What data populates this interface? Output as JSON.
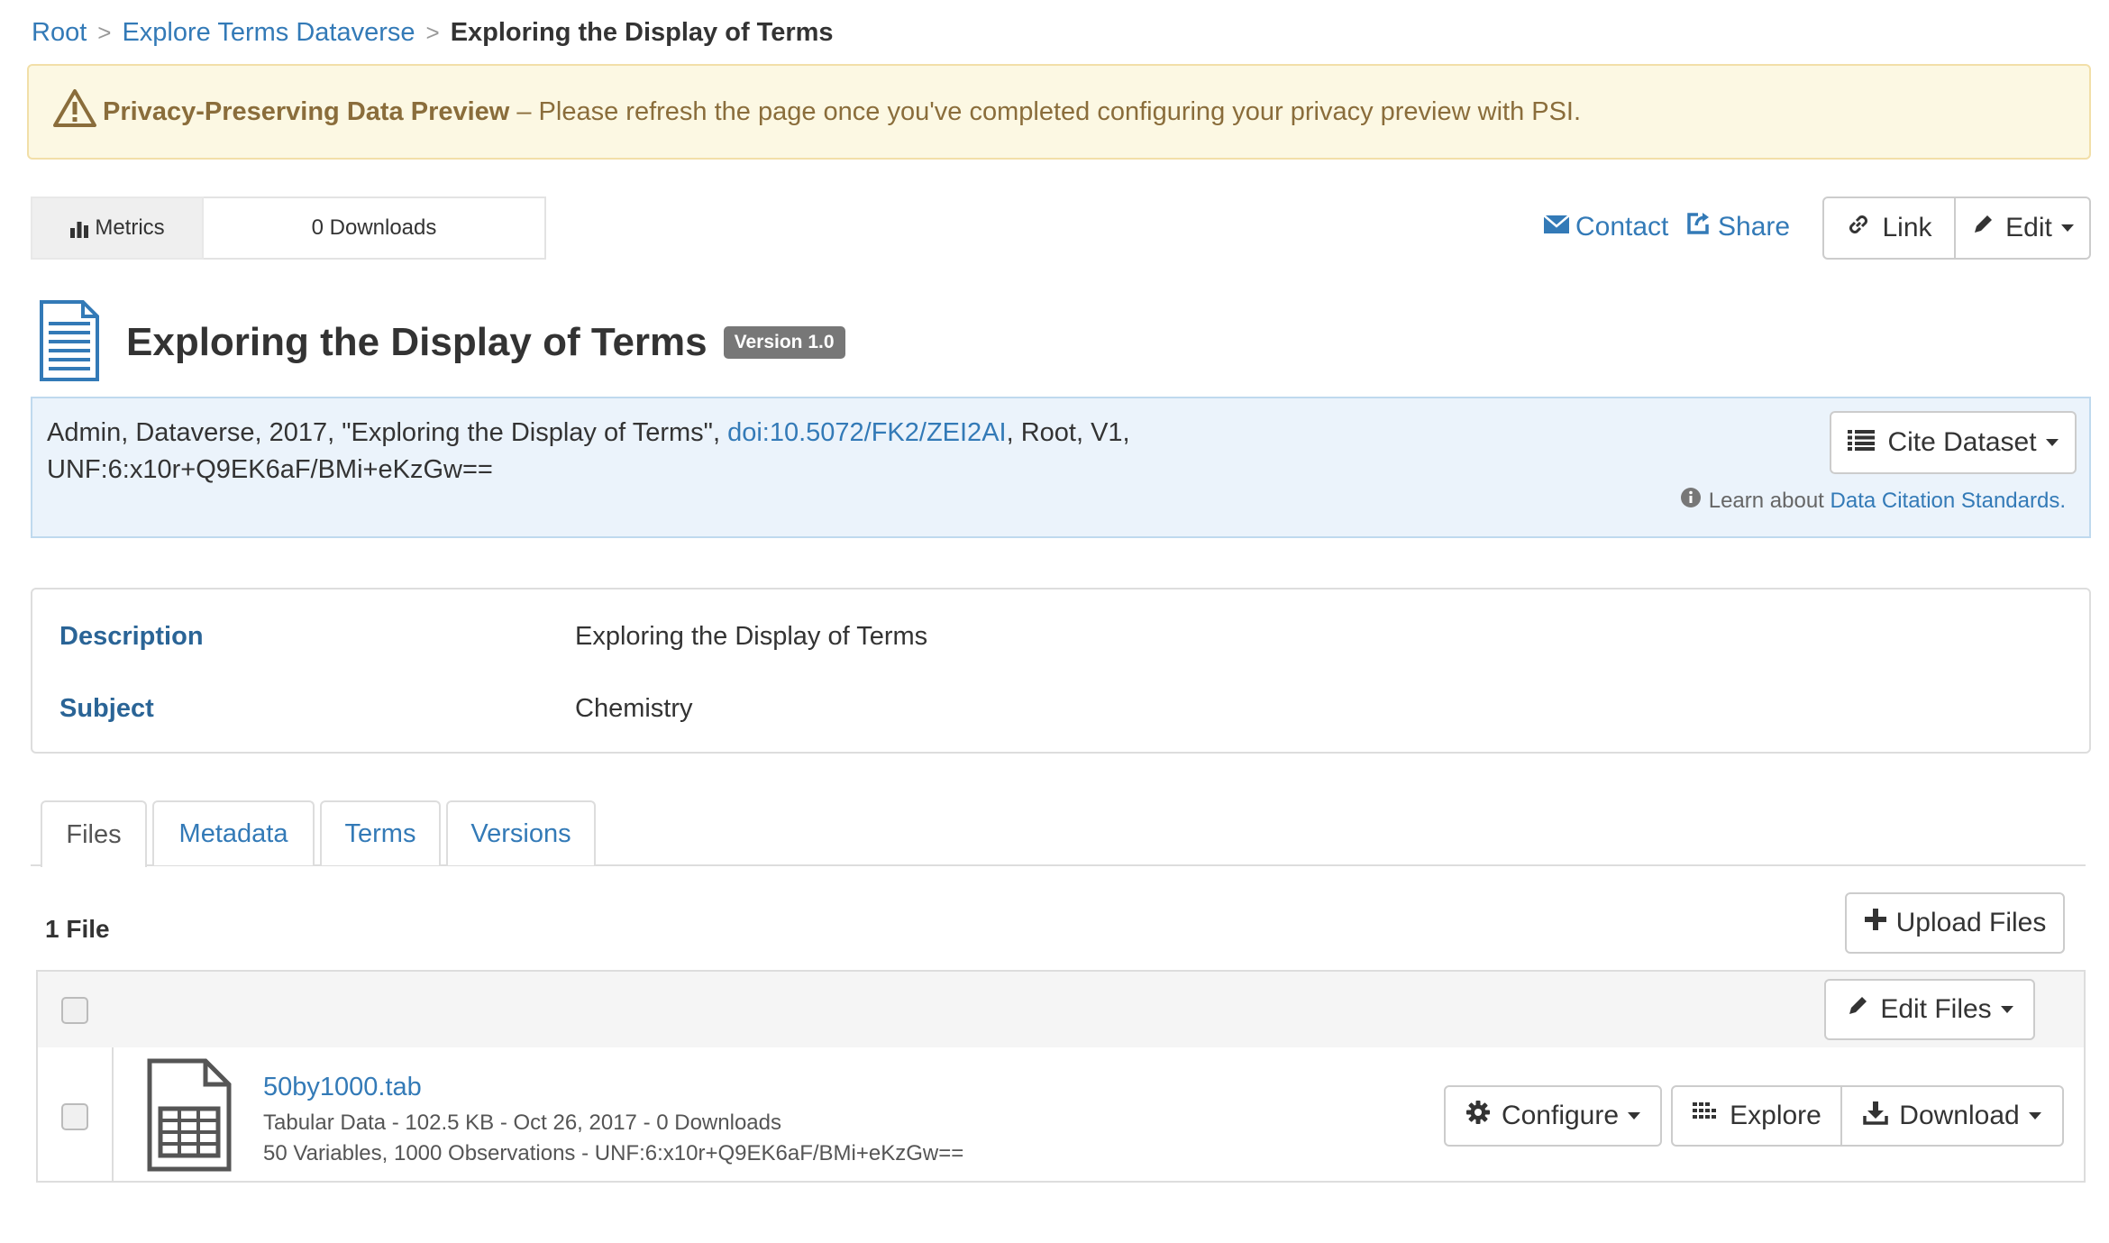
{
  "breadcrumb": {
    "root": "Root",
    "parent": "Explore Terms Dataverse",
    "current": "Exploring the Display of Terms",
    "separator": ">"
  },
  "alert": {
    "title": "Privacy-Preserving Data Preview",
    "message": "– Please refresh the page once you've completed configuring your privacy preview with PSI."
  },
  "metrics": {
    "label": "Metrics",
    "downloads": "0 Downloads"
  },
  "actions": {
    "contact": "Contact",
    "share": "Share",
    "link": "Link",
    "edit": "Edit"
  },
  "dataset": {
    "title": "Exploring the Display of Terms",
    "version": "Version 1.0"
  },
  "citation": {
    "text_before": "Admin, Dataverse, 2017, \"Exploring the Display of Terms\", ",
    "doi": "doi:10.5072/FK2/ZEI2AI",
    "text_after": ", Root, V1,",
    "unf": "UNF:6:x10r+Q9EK6aF/BMi+eKzGw==",
    "cite_button": "Cite Dataset",
    "learn_prefix": "Learn about",
    "learn_link": "Data Citation Standards."
  },
  "summary": {
    "description_label": "Description",
    "description_value": "Exploring the Display of Terms",
    "subject_label": "Subject",
    "subject_value": "Chemistry"
  },
  "tabs": [
    {
      "label": "Files"
    },
    {
      "label": "Metadata"
    },
    {
      "label": "Terms"
    },
    {
      "label": "Versions"
    }
  ],
  "files": {
    "count": "1 File",
    "upload": "Upload Files",
    "edit_files": "Edit Files",
    "items": [
      {
        "name": "50by1000.tab",
        "meta1": "Tabular Data - 102.5 KB - Oct 26, 2017 - 0 Downloads",
        "meta2": "50 Variables, 1000 Observations - UNF:6:x10r+Q9EK6aF/BMi+eKzGw==",
        "configure": "Configure",
        "explore": "Explore",
        "download": "Download"
      }
    ]
  },
  "colors": {
    "link": "#337ab7",
    "alert_bg": "#fcf8e3",
    "alert_text": "#8a6d3b",
    "citation_bg": "#ebf3fb",
    "badge": "#777777"
  }
}
